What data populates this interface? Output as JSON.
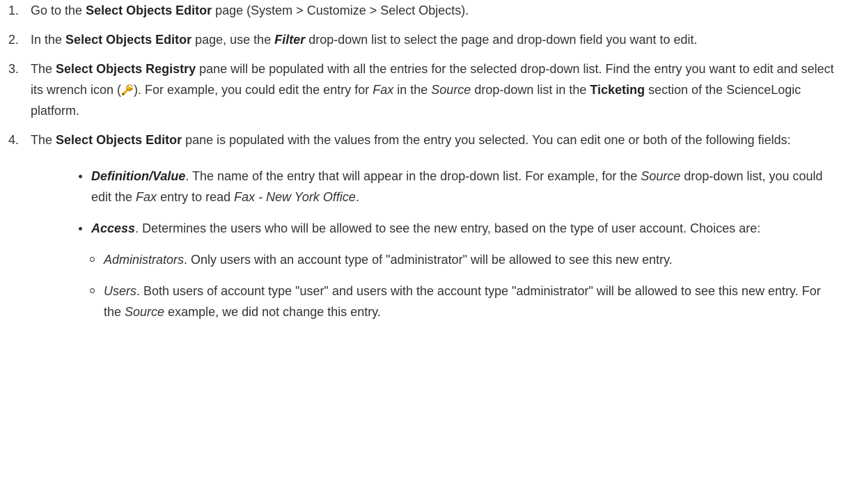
{
  "steps": [
    {
      "number": "1.",
      "t1": "Go to the ",
      "b1": "Select Objects Editor",
      "t2": " page (System > Customize > Select Objects)."
    },
    {
      "number": "2.",
      "t1": "In the ",
      "b1": "Select Objects Editor",
      "t2": " page, use the ",
      "f1": "Filter",
      "t3": " drop-down list to select the page and drop-down field you want to edit."
    },
    {
      "number": "3.",
      "t1": "The ",
      "b1": "Select Objects Registry",
      "t2": " pane will be populated with all the entries for the selected drop-down list. Find the entry you want to edit and select its wrench icon (",
      "icon": "wrench-icon",
      "t3": "). For example, you could edit the entry for ",
      "i1": "Fax",
      "t4": " in the ",
      "i2": "Source",
      "t5": " drop-down list in the ",
      "b2": "Ticketing",
      "t6": " section of the ScienceLogic platform."
    },
    {
      "number": "4.",
      "t1": "The ",
      "b1": "Select Objects Editor",
      "t2": " pane is populated with the values from the entry you selected. You can edit one or both of the following fields:"
    }
  ],
  "bullets": [
    {
      "field": "Definition/Value",
      "t1": ". The name of the entry that will appear in the drop-down list. For example, for the ",
      "i1": "Source",
      "t2": " drop-down list, you could edit the ",
      "i2": "Fax",
      "t3": " entry to read ",
      "i3": "Fax - New York Office",
      "t4": "."
    },
    {
      "field": "Access",
      "t1": ". Determines the users who will be allowed to see the new entry, based on the type of user account. Choices are:"
    }
  ],
  "sub_items": [
    {
      "term": "Administrators",
      "t1": ". Only users with an account type of \"administrator\" will be allowed to see this new entry."
    },
    {
      "term": "Users",
      "t1": ". Both users of account type \"user\" and users with the account type \"administrator\" will be allowed to see this new entry. For the ",
      "i1": "Source",
      "t2": " example, we did not change this entry."
    }
  ]
}
